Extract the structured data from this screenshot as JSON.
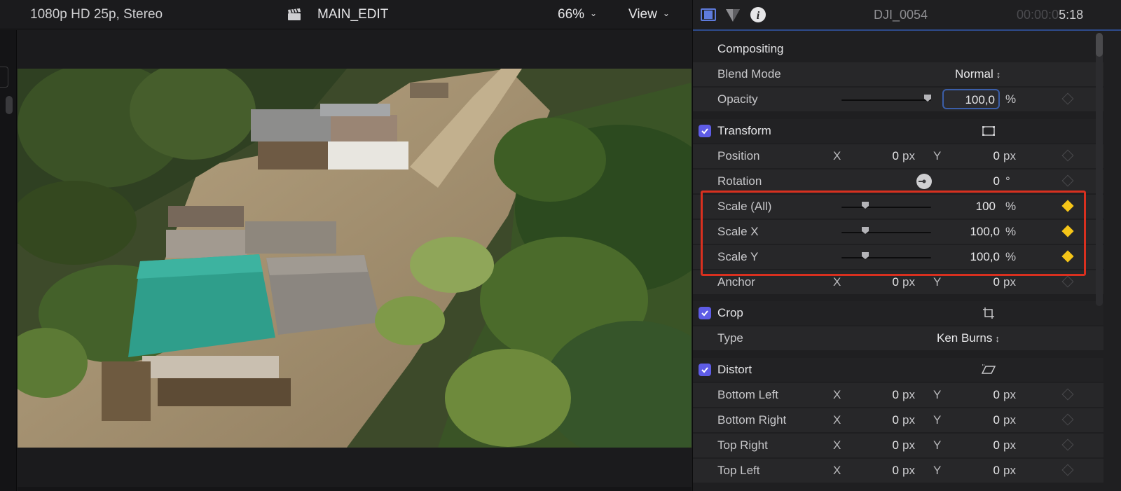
{
  "viewer": {
    "format": "1080p HD 25p, Stereo",
    "project_name": "MAIN_EDIT",
    "zoom": "66%",
    "view_menu": "View"
  },
  "inspector": {
    "tabs": [
      "video-icon",
      "color-icon",
      "info-icon"
    ],
    "clip_name": "DJI_0054",
    "timecode_dim": "00:00:0",
    "timecode_bright": "5:18",
    "compositing": {
      "heading": "Compositing",
      "blend_mode_label": "Blend Mode",
      "blend_mode_value": "Normal",
      "opacity_label": "Opacity",
      "opacity_value": "100,0",
      "opacity_unit": "%"
    },
    "transform": {
      "heading": "Transform",
      "position_label": "Position",
      "position": {
        "x_label": "X",
        "x": "0",
        "x_unit": "px",
        "y_label": "Y",
        "y": "0",
        "y_unit": "px"
      },
      "rotation_label": "Rotation",
      "rotation_value": "0",
      "rotation_unit": "°",
      "scale_all_label": "Scale (All)",
      "scale_all_value": "100",
      "scale_all_unit": "%",
      "scale_x_label": "Scale X",
      "scale_x_value": "100,0",
      "scale_x_unit": "%",
      "scale_y_label": "Scale Y",
      "scale_y_value": "100,0",
      "scale_y_unit": "%",
      "anchor_label": "Anchor",
      "anchor": {
        "x_label": "X",
        "x": "0",
        "x_unit": "px",
        "y_label": "Y",
        "y": "0",
        "y_unit": "px"
      }
    },
    "crop": {
      "heading": "Crop",
      "type_label": "Type",
      "type_value": "Ken Burns"
    },
    "distort": {
      "heading": "Distort",
      "bottom_left_label": "Bottom Left",
      "bottom_left": {
        "x_label": "X",
        "x": "0",
        "x_unit": "px",
        "y_label": "Y",
        "y": "0",
        "y_unit": "px"
      },
      "bottom_right_label": "Bottom Right",
      "bottom_right": {
        "x_label": "X",
        "x": "0",
        "x_unit": "px",
        "y_label": "Y",
        "y": "0",
        "y_unit": "px"
      },
      "top_right_label": "Top Right",
      "top_right": {
        "x_label": "X",
        "x": "0",
        "x_unit": "px",
        "y_label": "Y",
        "y": "0",
        "y_unit": "px"
      },
      "top_left_label": "Top Left",
      "top_left": {
        "x_label": "X",
        "x": "0",
        "x_unit": "px",
        "y_label": "Y",
        "y": "0",
        "y_unit": "px"
      }
    }
  },
  "colors": {
    "accent": "#5e5ce6",
    "keyframe_active": "#f5c518",
    "highlight_box": "#d9301f"
  }
}
